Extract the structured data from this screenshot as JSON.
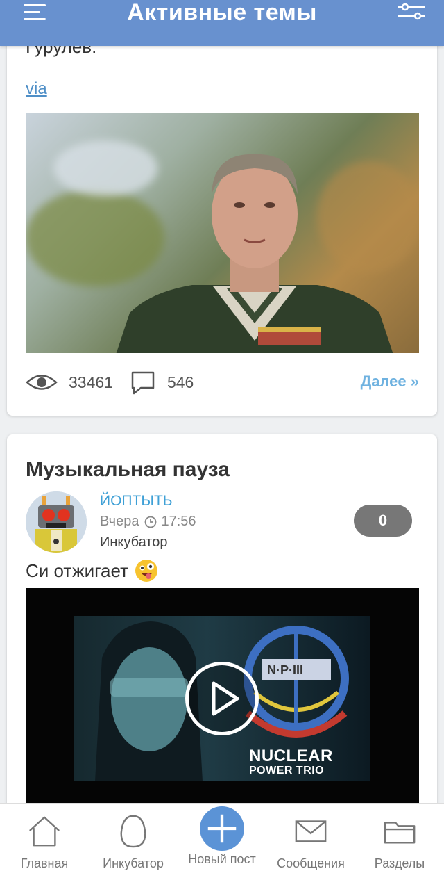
{
  "header": {
    "title": "Активные темы",
    "menu_icon": "menu-icon",
    "filter_icon": "filter-icon",
    "bg_color": "#6891cf"
  },
  "post1": {
    "cut_text": "Гурулев.",
    "via": "via",
    "views": "33461",
    "comments": "546",
    "more": "Далее »"
  },
  "post2": {
    "title": "Музыкальная пауза",
    "author": "ЙОПТЫТЬ",
    "date": "Вчера",
    "time": "17:56",
    "section": "Инкубатор",
    "comment_count": "0",
    "text": "Си отжигает",
    "video_title": "NUCLEAR",
    "video_subtitle": "POWER TRIO",
    "video_logo": "N·P·III"
  },
  "bottom_nav": {
    "items": [
      {
        "label": "Главная",
        "icon": "home-icon"
      },
      {
        "label": "Инкубатор",
        "icon": "egg-icon"
      },
      {
        "label": "Новый пост",
        "icon": "plus-icon"
      },
      {
        "label": "Сообщения",
        "icon": "envelope-icon"
      },
      {
        "label": "Разделы",
        "icon": "folder-icon"
      }
    ]
  },
  "colors": {
    "accent": "#5b93d6",
    "link": "#3fa0d6",
    "more_link": "#6fb2e0"
  }
}
